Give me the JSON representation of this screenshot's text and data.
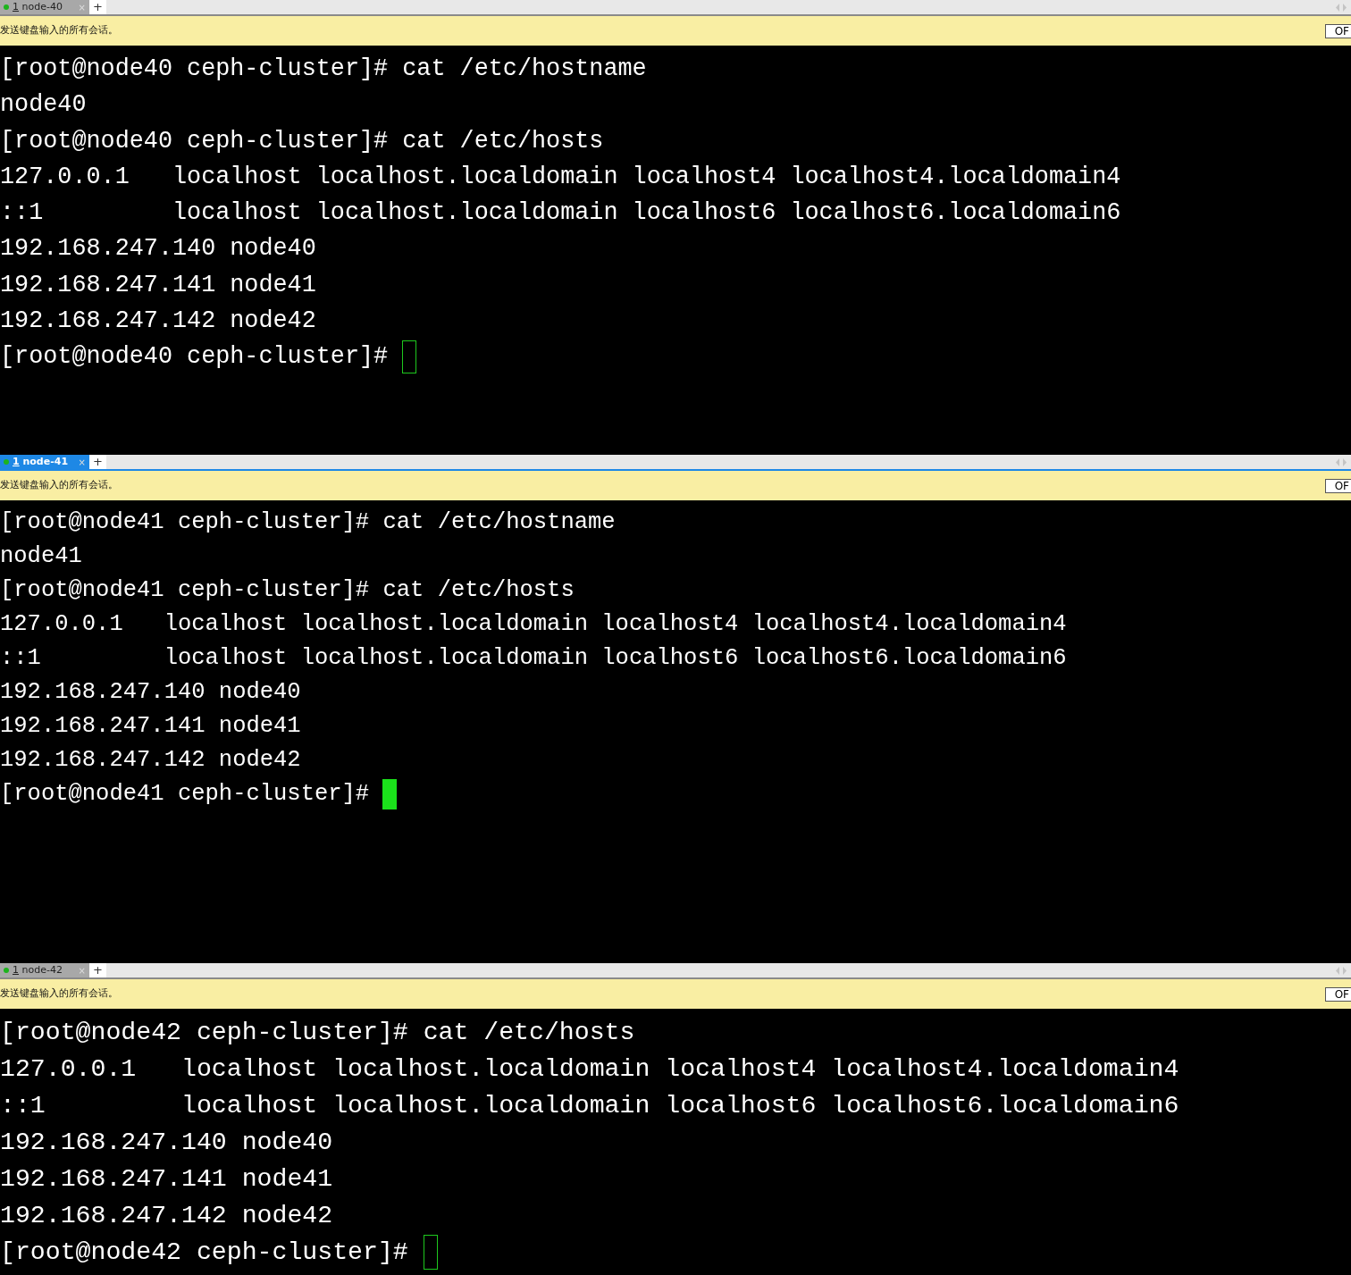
{
  "panes": [
    {
      "tab": {
        "number": "1",
        "label": "node-40",
        "close": "×",
        "selected": false
      },
      "new_tab": "+",
      "broadcast": {
        "text": "发送键盘输入的所有会话。",
        "button": "OF"
      },
      "lines": [
        "[root@node40 ceph-cluster]# cat /etc/hostname",
        "node40",
        "[root@node40 ceph-cluster]# cat /etc/hosts",
        "127.0.0.1   localhost localhost.localdomain localhost4 localhost4.localdomain4",
        "::1         localhost localhost.localdomain localhost6 localhost6.localdomain6",
        "192.168.247.140 node40",
        "192.168.247.141 node41",
        "192.168.247.142 node42"
      ],
      "prompt": "[root@node40 ceph-cluster]# ",
      "cursor_focused": false
    },
    {
      "tab": {
        "number": "1",
        "label": "node-41",
        "close": "×",
        "selected": true
      },
      "new_tab": "+",
      "broadcast": {
        "text": "发送键盘输入的所有会话。",
        "button": "OF"
      },
      "lines": [
        "[root@node41 ceph-cluster]# cat /etc/hostname",
        "node41",
        "[root@node41 ceph-cluster]# cat /etc/hosts",
        "127.0.0.1   localhost localhost.localdomain localhost4 localhost4.localdomain4",
        "::1         localhost localhost.localdomain localhost6 localhost6.localdomain6",
        "192.168.247.140 node40",
        "192.168.247.141 node41",
        "192.168.247.142 node42"
      ],
      "prompt": "[root@node41 ceph-cluster]# ",
      "cursor_focused": true
    },
    {
      "tab": {
        "number": "1",
        "label": "node-42",
        "close": "×",
        "selected": false
      },
      "new_tab": "+",
      "broadcast": {
        "text": "发送键盘输入的所有会话。",
        "button": "OF"
      },
      "lines": [
        "[root@node42 ceph-cluster]# cat /etc/hosts",
        "127.0.0.1   localhost localhost.localdomain localhost4 localhost4.localdomain4",
        "::1         localhost localhost.localdomain localhost6 localhost6.localdomain6",
        "192.168.247.140 node40",
        "192.168.247.141 node41",
        "192.168.247.142 node42"
      ],
      "prompt": "[root@node42 ceph-cluster]# ",
      "cursor_focused": false
    }
  ]
}
